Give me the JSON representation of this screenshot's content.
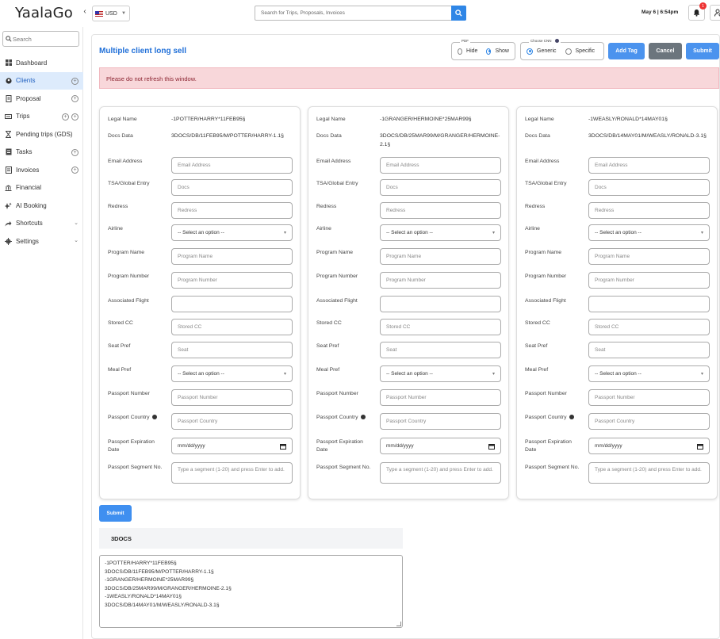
{
  "header": {
    "logo": "YaalaGo",
    "currency": "USD",
    "search_placeholder": "Search for Trips, Proposals, Invoices",
    "datetime": "May 6 | 6:54pm",
    "notification_count": "1"
  },
  "sidebar": {
    "search_placeholder": "Search",
    "items": [
      {
        "label": "Dashboard",
        "icon": "grid-icon"
      },
      {
        "label": "Clients",
        "icon": "clients-icon"
      },
      {
        "label": "Proposal",
        "icon": "document-icon"
      },
      {
        "label": "Trips",
        "icon": "trips-icon"
      },
      {
        "label": "Pending trips (GDS)",
        "icon": "hourglass-icon"
      },
      {
        "label": "Tasks",
        "icon": "tasks-icon"
      },
      {
        "label": "Invoices",
        "icon": "invoice-icon"
      },
      {
        "label": "Financial",
        "icon": "bank-icon"
      },
      {
        "label": "AI Booking",
        "icon": "sparkle-icon"
      },
      {
        "label": "Shortcuts",
        "icon": "share-icon"
      },
      {
        "label": "Settings",
        "icon": "gear-icon"
      }
    ]
  },
  "page": {
    "title": "Multiple client long sell",
    "pdf_legend": "PDF",
    "pdf_hide": "Hide",
    "pdf_show": "Show",
    "cnn_legend": "Choose CNN",
    "cnn_generic": "Generic",
    "cnn_specific": "Specific",
    "add_tag": "Add Tag",
    "cancel": "Cancel",
    "submit": "Submit",
    "alert": "Please do not refresh this window."
  },
  "labels": {
    "legal_name": "Legal Name",
    "docs_data": "Docs Data",
    "email": "Email Address",
    "tsa": "TSA/Global Entry",
    "redress": "Redress",
    "airline": "Airline",
    "program_name": "Program Name",
    "program_number": "Program Number",
    "associated_flight": "Associated Flight",
    "stored_cc": "Stored CC",
    "seat_pref": "Seat Pref",
    "meal_pref": "Meal Pref",
    "passport_number": "Passport Number",
    "passport_country": "Passport Country",
    "passport_expiration": "Passport Expiration Date",
    "passport_segment": "Passport Segment No."
  },
  "placeholders": {
    "email": "Email Address",
    "tsa": "Docs",
    "redress": "Redress",
    "select": "-- Select an option --",
    "program_name": "Program Name",
    "program_number": "Program Number",
    "associated_flight": "",
    "stored_cc": "Stored CC",
    "seat": "Seat",
    "passport_number": "Passport Number",
    "passport_country": "Passport Country",
    "date": "mm/dd/yyyy",
    "segment": "Type a segment (1-20) and press Enter to add."
  },
  "clients": [
    {
      "legal_name": "-1POTTER/HARRY*11FEB95§",
      "docs_data": "3DOCS/DB/11FEB95/M/POTTER/HARRY-1.1§"
    },
    {
      "legal_name": "-1GRANGER/HERMOINE*25MAR99§",
      "docs_data": "3DOCS/DB/25MAR99/M/GRANGER/HERMOINE-2.1§"
    },
    {
      "legal_name": "-1WEASLY/RONALD*14MAY01§",
      "docs_data": "3DOCS/DB/14MAY01/M/WEASLY/RONALD-3.1§"
    }
  ],
  "footer": {
    "submit": "Submit",
    "heading": "3DOCS",
    "output_lines": [
      "-1POTTER/HARRY*11FEB95§",
      "3DOCS/DB/11FEB95/M/POTTER/HARRY-1.1§",
      "-1GRANGER/HERMOINE*25MAR99§",
      "3DOCS/DB/25MAR99/M/GRANGER/HERMOINE-2.1§",
      "-1WEASLY/RONALD*14MAY01§",
      "3DOCS/DB/14MAY01/M/WEASLY/RONALD-3.1§"
    ]
  }
}
